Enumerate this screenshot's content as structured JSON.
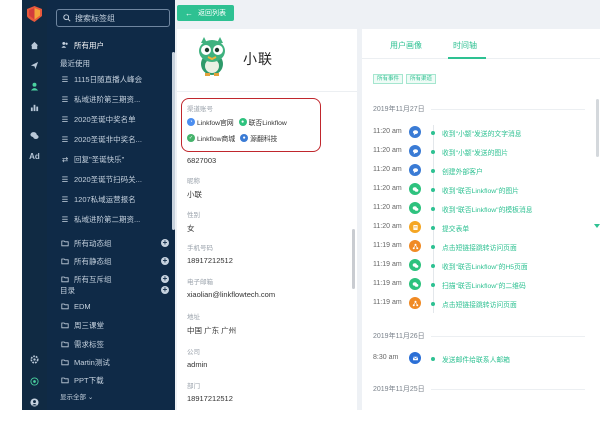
{
  "colors": {
    "rail_bg": "#102a43",
    "panel_bg": "#0f2a47",
    "accent": "#2ec192",
    "highlight": "#c0272d"
  },
  "rail": {
    "icons": [
      "home-icon",
      "send-icon",
      "user-icon",
      "bar-chart-icon",
      "chat-icon"
    ],
    "ad_label": "Ad",
    "bottom_icons": [
      "settings-icon",
      "help-icon",
      "account-icon"
    ]
  },
  "tagpanel": {
    "search_placeholder": "搜索标签组",
    "all_users": "所有用户",
    "recent_title": "最近使用",
    "recent": [
      "1115日随直播人峰会",
      "私域进阶第三期资...",
      "2020圣诞中奖名单",
      "2020圣诞非中奖名...",
      "回复\"圣诞快乐\"",
      "2020圣诞节扫码关...",
      "1207私域运营报名",
      "私域进阶第二期资..."
    ],
    "groups": [
      "所有动态组",
      "所有静态组",
      "所有互斥组"
    ],
    "dir_title": "目录",
    "dirs": [
      "EDM",
      "周三课堂",
      "需求标签",
      "Martin测试",
      "PPT下载"
    ],
    "show_all": "显示全部"
  },
  "back_button": "返回列表",
  "profile": {
    "name": "小联",
    "account_label": "渠道账号",
    "accounts": [
      {
        "name": "Linkfow官网",
        "color": "#4c8ef0"
      },
      {
        "name": "联否Linkflow",
        "color": "#2ec27e"
      },
      {
        "name": "Linkflow商城",
        "color": "#45b36b"
      },
      {
        "name": "源翻科技",
        "color": "#3a7bd5"
      }
    ],
    "id_value": "6827003",
    "fields": [
      {
        "label": "昵称",
        "value": "小联"
      },
      {
        "label": "性别",
        "value": "女"
      },
      {
        "label": "手机号码",
        "value": "18917212512"
      },
      {
        "label": "电子邮箱",
        "value": "xiaolian@linkflowtech.com"
      },
      {
        "label": "地址",
        "value": "中国 广东 广州"
      },
      {
        "label": "公司",
        "value": "admin"
      },
      {
        "label": "部门",
        "value": "18917212512"
      }
    ]
  },
  "timeline": {
    "tabs": [
      "用户画像",
      "时间轴"
    ],
    "active_tab": "时间轴",
    "filters": [
      "所有事件",
      "所有渠道"
    ],
    "days": [
      {
        "date": "2019年11月27日",
        "events": [
          {
            "time": "11:20 am",
            "icon": "chat-icon",
            "color": "#3a7bd5",
            "text": "收到\"小颛\"发送的文字消息"
          },
          {
            "time": "11:20 am",
            "icon": "chat-icon",
            "color": "#3a7bd5",
            "text": "收到\"小颛\"发送的图片"
          },
          {
            "time": "11:20 am",
            "icon": "chat-icon",
            "color": "#3a7bd5",
            "text": "创建外部客户"
          },
          {
            "time": "11:20 am",
            "icon": "wechat-icon",
            "color": "#2ec27e",
            "text": "收到\"联否Linkflow\"的图片"
          },
          {
            "time": "11:20 am",
            "icon": "wechat-icon",
            "color": "#2ec27e",
            "text": "收到\"联否Linkflow\"的模板消息"
          },
          {
            "time": "11:20 am",
            "icon": "form-icon",
            "color": "#f5a623",
            "text": "提交表单"
          },
          {
            "time": "11:19 am",
            "icon": "tree-icon",
            "color": "#f08a24",
            "text": "点击短链接跳转访问页面"
          },
          {
            "time": "11:19 am",
            "icon": "wechat-icon",
            "color": "#2ec27e",
            "text": "收到\"联否Linkflow\"的H5页面"
          },
          {
            "time": "11:19 am",
            "icon": "wechat-icon",
            "color": "#2ec27e",
            "text": "扫描\"联否Linkflow\"的二维码"
          },
          {
            "time": "11:19 am",
            "icon": "tree-icon",
            "color": "#f08a24",
            "text": "点击短链接跳转访问页面"
          }
        ]
      },
      {
        "date": "2019年11月26日",
        "events": [
          {
            "time": "8:30 am",
            "icon": "mail-icon",
            "color": "#2b6fd6",
            "text": "发送邮件给联系人邮箱"
          }
        ]
      },
      {
        "date": "2019年11月25日",
        "events": []
      }
    ]
  }
}
